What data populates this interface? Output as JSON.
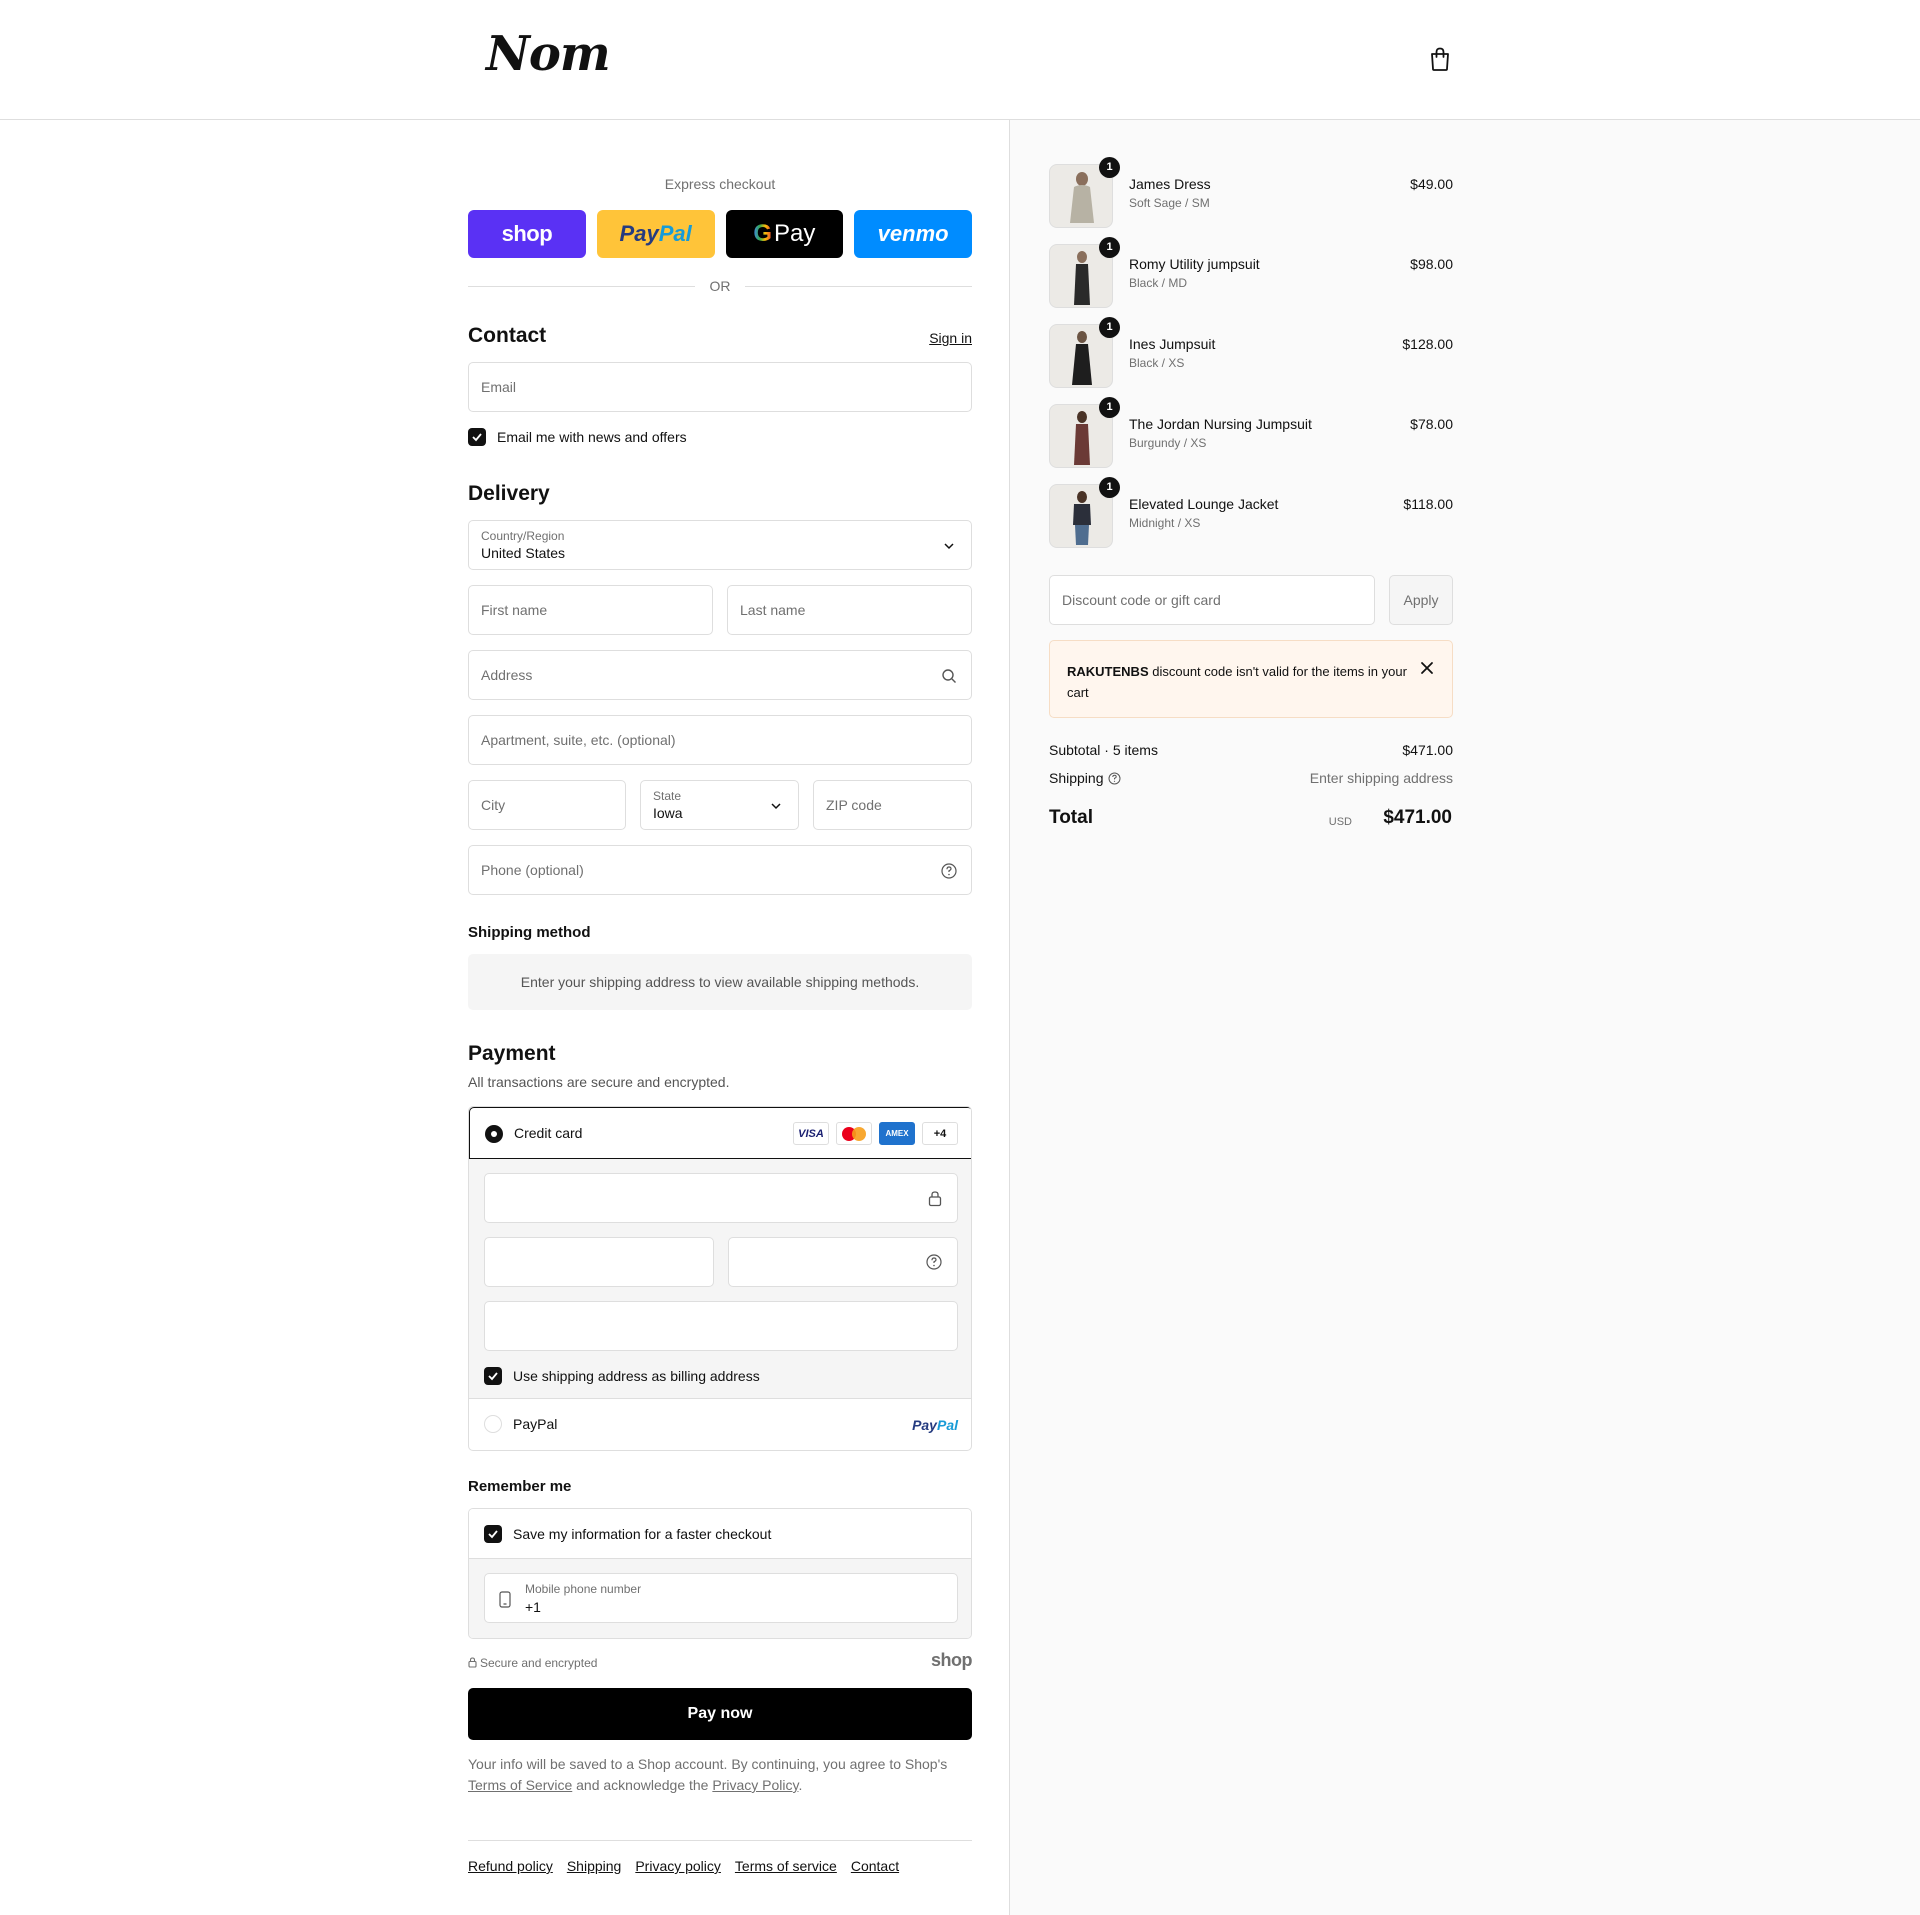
{
  "brand": {
    "logo_text": "Nom"
  },
  "express": {
    "title": "Express checkout",
    "shop_label": "shop",
    "paypal_label_a": "Pay",
    "paypal_label_b": "Pal",
    "gpay_g": "G",
    "gpay_label": "Pay",
    "venmo_label": "venmo",
    "or_label": "OR"
  },
  "contact": {
    "heading": "Contact",
    "sign_in": "Sign in",
    "email_placeholder": "Email",
    "newsletter_label": "Email me with news and offers"
  },
  "delivery": {
    "heading": "Delivery",
    "country_label": "Country/Region",
    "country_value": "United States",
    "first_name_placeholder": "First name",
    "last_name_placeholder": "Last name",
    "address_placeholder": "Address",
    "apartment_placeholder": "Apartment, suite, etc. (optional)",
    "city_placeholder": "City",
    "state_label": "State",
    "state_value": "Iowa",
    "zip_placeholder": "ZIP code",
    "phone_placeholder": "Phone (optional)"
  },
  "shipping_method": {
    "heading": "Shipping method",
    "message": "Enter your shipping address to view available shipping methods."
  },
  "payment": {
    "heading": "Payment",
    "subtitle": "All transactions are secure and encrypted.",
    "credit_card_label": "Credit card",
    "card_visa": "VISA",
    "card_amex": "AMEX",
    "card_more": "+4",
    "billing_label": "Use shipping address as billing address",
    "paypal_label": "PayPal",
    "paypal_logo_a": "Pay",
    "paypal_logo_b": "Pal"
  },
  "remember": {
    "heading": "Remember me",
    "save_label": "Save my information for a faster checkout",
    "mobile_label": "Mobile phone number",
    "mobile_value": "+1"
  },
  "secure_text": "Secure and encrypted",
  "shop_mark": "shop",
  "pay_now": "Pay now",
  "legal": {
    "text_a": "Your info will be saved to a Shop account. By continuing, you agree to Shop's",
    "terms_link": "Terms of Service",
    "text_b": "and acknowledge the",
    "privacy_link": "Privacy Policy",
    "text_c": "."
  },
  "footer_links": [
    "Refund policy",
    "Shipping",
    "Privacy policy",
    "Terms of service",
    "Contact"
  ],
  "cart": {
    "items": [
      {
        "name": "James Dress",
        "variant": "Soft Sage / SM",
        "price": "$49.00",
        "qty": "1",
        "color": "#b7b2a4"
      },
      {
        "name": "Romy Utility jumpsuit",
        "variant": "Black / MD",
        "price": "$98.00",
        "qty": "1",
        "color": "#2a2a2a"
      },
      {
        "name": "Ines Jumpsuit",
        "variant": "Black / XS",
        "price": "$128.00",
        "qty": "1",
        "color": "#1e1e1e"
      },
      {
        "name": "The Jordan Nursing Jumpsuit",
        "variant": "Burgundy / XS",
        "price": "$78.00",
        "qty": "1",
        "color": "#6b3a36"
      },
      {
        "name": "Elevated Lounge Jacket",
        "variant": "Midnight / XS",
        "price": "$118.00",
        "qty": "1",
        "color": "#2b2f3a"
      }
    ],
    "discount_placeholder": "Discount code or gift card",
    "apply_label": "Apply",
    "error_code": "RAKUTENBS",
    "error_text": " discount code isn't valid for the items in your cart",
    "subtotal_label": "Subtotal · 5 items",
    "subtotal_value": "$471.00",
    "shipping_label": "Shipping",
    "shipping_value": "Enter shipping address",
    "total_label": "Total",
    "total_currency": "USD",
    "total_value": "$471.00"
  }
}
